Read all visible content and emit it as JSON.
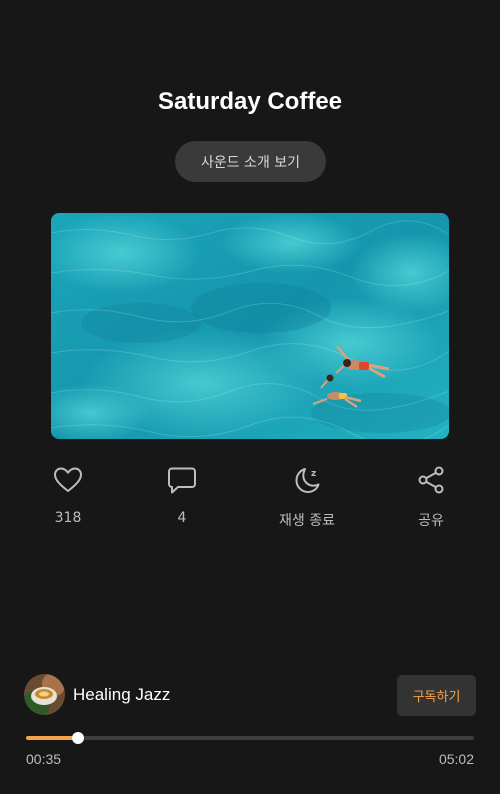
{
  "title": "Saturday Coffee",
  "intro_button": "사운드 소개 보기",
  "actions": [
    {
      "icon": "heart-icon",
      "label": "318"
    },
    {
      "icon": "comment-icon",
      "label": "4"
    },
    {
      "icon": "sleep-timer-icon",
      "label": "재생 종료"
    },
    {
      "icon": "share-icon",
      "label": "공유"
    }
  ],
  "channel": {
    "name": "Healing Jazz",
    "subscribe_label": "구독하기"
  },
  "player": {
    "current_time": "00:35",
    "total_time": "05:02",
    "progress": 0.116
  },
  "colors": {
    "background": "#171717",
    "accent": "#f4a34a"
  }
}
